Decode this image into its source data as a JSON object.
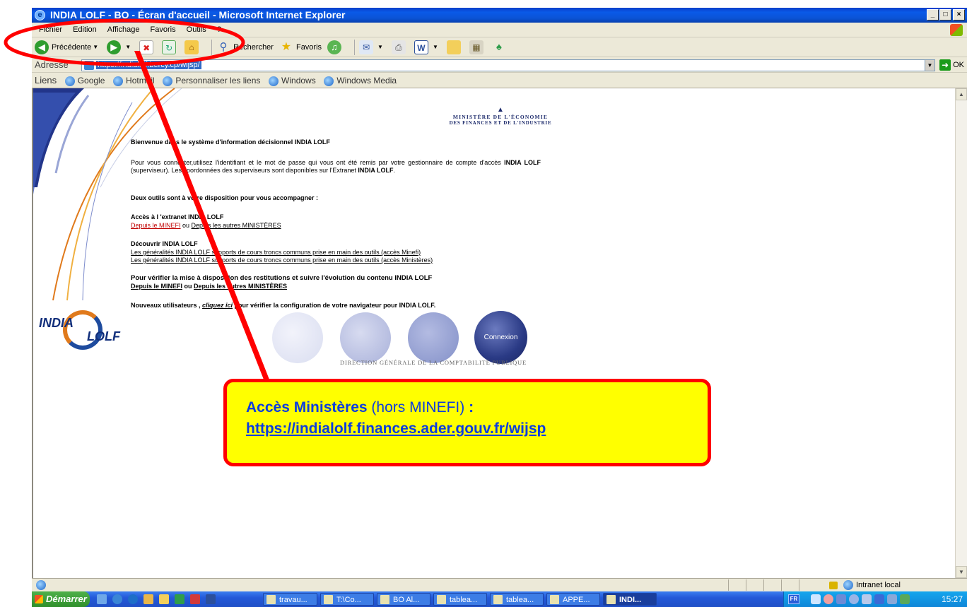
{
  "window": {
    "title": "INDIA LOLF - BO - Écran d'accueil - Microsoft Internet Explorer",
    "min": "_",
    "max": "□",
    "close": "×"
  },
  "menu": [
    "Fichier",
    "Edition",
    "Affichage",
    "Favoris",
    "Outils",
    "?"
  ],
  "toolbar": {
    "back_label": "Précédente",
    "search_label": "Rechercher",
    "favorites_label": "Favoris"
  },
  "address": {
    "label": "Adresse",
    "url": "https://indialolf.bercy.cp/wijsp/",
    "go_label": "OK"
  },
  "links": {
    "label": "Liens",
    "items": [
      "Google",
      "Hotmail",
      "Personnaliser les liens",
      "Windows",
      "Windows Media"
    ]
  },
  "page": {
    "ministry_line1": "MINISTÈRE DE L'ÉCONOMIE",
    "ministry_line2": "DES FINANCES ET DE L'INDUSTRIE",
    "welcome": "Bienvenue dans le système d'information décisionnel INDIA LOLF",
    "intro_a": "Pour vous connecter,utilisez l'identifiant et le mot de passe qui vous ont été remis par votre gestionnaire de compte d'accès ",
    "intro_b": "INDIA LOLF",
    "intro_c": " (superviseur). Les coordonnées des superviseurs sont disponibles sur l'Extranet ",
    "intro_d": "INDIA LOLF",
    "intro_e": ".",
    "tools_heading": "Deux outils sont à votre disposition pour vous accompagner :",
    "extranet_heading": "Accès à l 'extranet INDIA LOLF",
    "extranet_link1": "Depuis le MINEFI",
    "extranet_or": " ou ",
    "extranet_link2": "Depuis les autres MINISTÈRES",
    "discover_heading": "Découvrir INDIA LOLF",
    "discover_link1": "Les généralités INDIA LOLF supports de cours troncs communs prise en main des outils (accès Minefi)",
    "discover_link2": "Les généralités INDIA LOLF supports de cours troncs communs prise en main des outils (accès Ministères)",
    "verify_heading": "Pour vérifier la mise à disposition des restitutions et suivre l'évolution du contenu INDIA LOLF",
    "verify_link1": "Depuis le MINEFI",
    "verify_or": " ou ",
    "verify_link2": "Depuis les autres MINISTÈRES",
    "new_users_a": "Nouveaux utilisateurs , ",
    "new_users_link": "cliquez ici",
    "new_users_b": " pour vérifier la configuration de votre navigateur pour INDIA LOLF.",
    "logo_india": "INDIA",
    "logo_lolf": "LOLF",
    "connexion_label": "Connexion",
    "dgcp": "DIRECTION GÉNÉRALE DE LA COMPTABILITÉ PUBLIQUE"
  },
  "callout": {
    "title": "Accès Ministères",
    "sub": " (hors MINEFI) ",
    "colon": ":",
    "url": "https://indialolf.finances.ader.gouv.fr/wijsp"
  },
  "status": {
    "zone": "Intranet local"
  },
  "taskbar": {
    "start": "Démarrer",
    "tasks": [
      "travau...",
      "T:\\Co...",
      "BO Al...",
      "tablea...",
      "tablea...",
      "APPE...",
      "INDI..."
    ],
    "lang": "FR",
    "clock": "15:27"
  },
  "colors": {
    "annotation_red": "#ff0000",
    "callout_fill": "#ffff00",
    "callout_text": "#0b3ce0"
  }
}
